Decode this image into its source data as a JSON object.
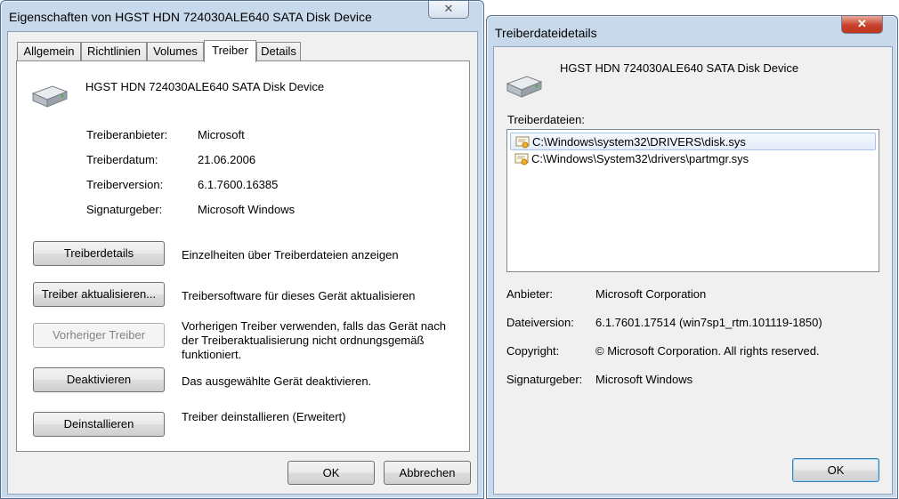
{
  "left_dialog": {
    "title": "Eigenschaften von HGST HDN 724030ALE640 SATA Disk Device",
    "tabs": [
      {
        "label": "Allgemein"
      },
      {
        "label": "Richtlinien"
      },
      {
        "label": "Volumes"
      },
      {
        "label": "Treiber"
      },
      {
        "label": "Details"
      }
    ],
    "device_name": "HGST HDN 724030ALE640 SATA Disk Device",
    "fields": [
      {
        "label": "Treiberanbieter:",
        "value": "Microsoft"
      },
      {
        "label": "Treiberdatum:",
        "value": "21.06.2006"
      },
      {
        "label": "Treiberversion:",
        "value": "6.1.7600.16385"
      },
      {
        "label": "Signaturgeber:",
        "value": "Microsoft Windows"
      }
    ],
    "actions": [
      {
        "button": "Treiberdetails",
        "description": "Einzelheiten über Treiberdateien anzeigen"
      },
      {
        "button": "Treiber aktualisieren...",
        "description": "Treibersoftware für dieses Gerät aktualisieren"
      },
      {
        "button": "Vorheriger Treiber",
        "description_lines": [
          "Vorherigen Treiber verwenden, falls das Gerät nach",
          "der Treiberaktualisierung nicht ordnungsgemäß",
          "funktioniert."
        ]
      },
      {
        "button": "Deaktivieren",
        "description": "Das ausgewählte Gerät deaktivieren."
      },
      {
        "button": "Deinstallieren",
        "description": "Treiber deinstallieren (Erweitert)"
      }
    ],
    "ok_label": "OK",
    "cancel_label": "Abbrechen"
  },
  "right_dialog": {
    "title": "Treiberdateidetails",
    "device_name": "HGST HDN 724030ALE640 SATA Disk Device",
    "files_label": "Treiberdateien:",
    "files": [
      "C:\\Windows\\system32\\DRIVERS\\disk.sys",
      "C:\\Windows\\System32\\drivers\\partmgr.sys"
    ],
    "fields": [
      {
        "label": "Anbieter:",
        "value": "Microsoft Corporation"
      },
      {
        "label": "Dateiversion:",
        "value": "6.1.7601.17514 (win7sp1_rtm.101119-1850)"
      },
      {
        "label": "Copyright:",
        "value": "© Microsoft Corporation. All rights reserved."
      },
      {
        "label": "Signaturgeber:",
        "value": "Microsoft Windows"
      }
    ],
    "ok_label": "OK"
  },
  "icons": {
    "close": "close-icon",
    "device": "hard-disk-icon",
    "file": "certificate-file-icon"
  },
  "colors": {
    "frame": "#c8d9ec",
    "close_active": "#c8412c",
    "selection": "#e3ecfa"
  }
}
